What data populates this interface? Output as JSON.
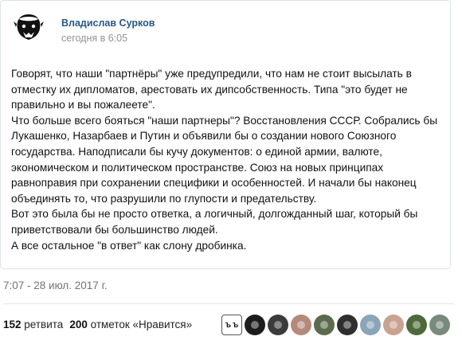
{
  "post": {
    "author_name": "Владислав Сурков",
    "posted_time": "сегодня в 6:05",
    "paragraphs": [
      "Говорят, что наши \"партнёры\" уже предупредили, что нам не стоит высылать в",
      "отместку их дипломатов, арестовать их дипсобственность. Типа \"это будет не",
      "правильно и вы пожалеете\".",
      "Что больше всего бояться \"наши партнеры\"? Восстановления СССР. Собрались бы",
      "Лукашенко, Назарбаев и Путин и объявили бы о создании нового Союзного",
      "государства. Наподписали бы кучу документов: о единой армии, валюте,",
      "экономическом и политическом пространстве. Союз на новых принципах",
      "равноправия при сохранении специфики и особенностей. И начали бы наконец",
      "объединять то, что разрушили по глупости и предательству.",
      "Вот это была бы не просто ответка, а логичный, долгожданный шаг, который бы",
      "приветствовали бы большинство людей.",
      "А все остальное \"в ответ\" как слону дробинка."
    ]
  },
  "tweet": {
    "date": "7:07 - 28 июл. 2017 г.",
    "retweets_count": "152",
    "retweets_label": "ретвита",
    "likes_count": "200",
    "likes_label": "отметок «Нравится»",
    "liker_avatars": [
      {
        "icon": "liker-avatar-icon",
        "color": "#ffffff",
        "text": "Ъ Ъ"
      },
      {
        "icon": "liker-avatar-icon",
        "color": "#1c1c1c"
      },
      {
        "icon": "liker-avatar-icon",
        "color": "#3b3b3b"
      },
      {
        "icon": "liker-avatar-icon",
        "color": "#b48a7a"
      },
      {
        "icon": "liker-avatar-icon",
        "color": "#5a6b4e"
      },
      {
        "icon": "liker-avatar-icon",
        "color": "#2f2f2f"
      },
      {
        "icon": "liker-avatar-icon",
        "color": "#8aa4b8"
      },
      {
        "icon": "liker-avatar-icon",
        "color": "#c9a390"
      },
      {
        "icon": "liker-avatar-icon",
        "color": "#4f6a3a"
      },
      {
        "icon": "liker-avatar-icon",
        "color": "#7a8a7a"
      }
    ]
  },
  "colors": {
    "author_link": "#2a5885",
    "muted": "#939393"
  }
}
